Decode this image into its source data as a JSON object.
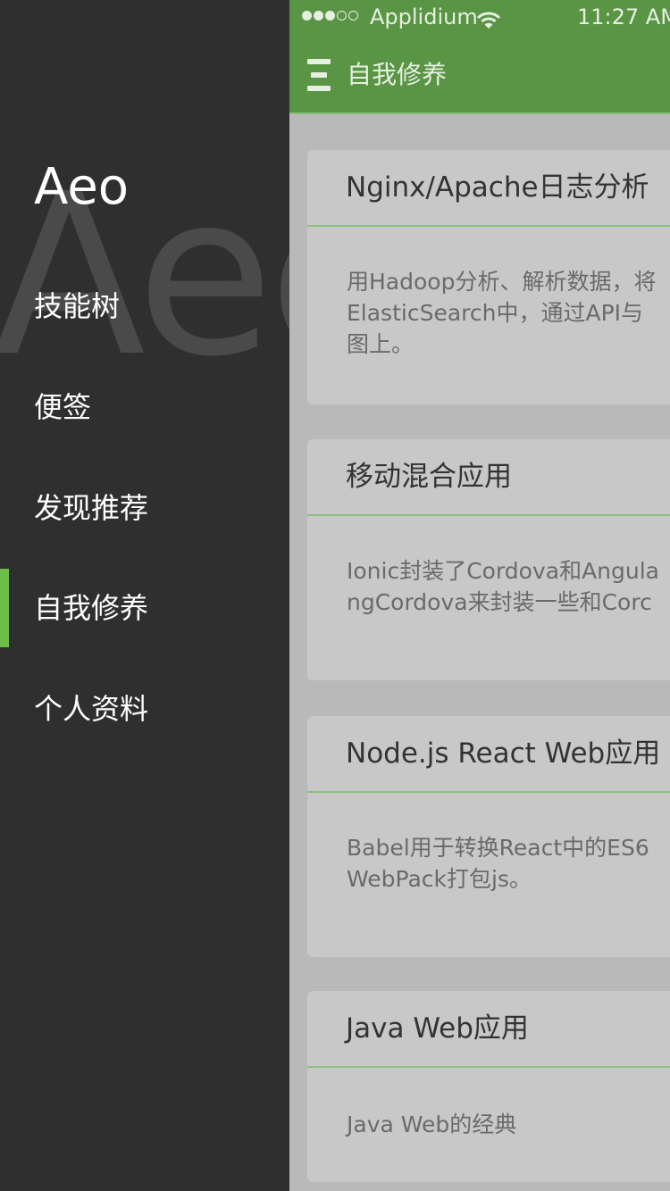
{
  "side_menu": {
    "brand": "Aeo",
    "watermark": "Aeo",
    "items": [
      {
        "label": "技能树",
        "active": false
      },
      {
        "label": "便签",
        "active": false
      },
      {
        "label": "发现推荐",
        "active": false
      },
      {
        "label": "自我修养",
        "active": true
      },
      {
        "label": "个人资料",
        "active": false
      }
    ],
    "accent_color": "#6cc04a"
  },
  "status_bar": {
    "carrier": "Applidium",
    "time": "11:27 AM",
    "signal_dots_full": 3,
    "signal_dots_total": 5
  },
  "header": {
    "title": "自我修养",
    "menu_icon": "hamburger-menu-icon",
    "bg_color": "#5a9445"
  },
  "cards": [
    {
      "title": "Nginx/Apache日志分析",
      "body_lines": [
        "用Hadoop分析、解析数据，将",
        "ElasticSearch中，通过API与",
        "图上。"
      ]
    },
    {
      "title": "移动混合应用",
      "body_lines": [
        "Ionic封装了Cordova和Angula",
        "ngCordova来封装一些和Corc"
      ]
    },
    {
      "title": "Node.js React Web应用",
      "body_lines": [
        "Babel用于转换React中的ES6",
        "WebPack打包js。"
      ]
    },
    {
      "title": "Java Web应用",
      "body_lines": [
        "Java Web的经典"
      ]
    }
  ]
}
